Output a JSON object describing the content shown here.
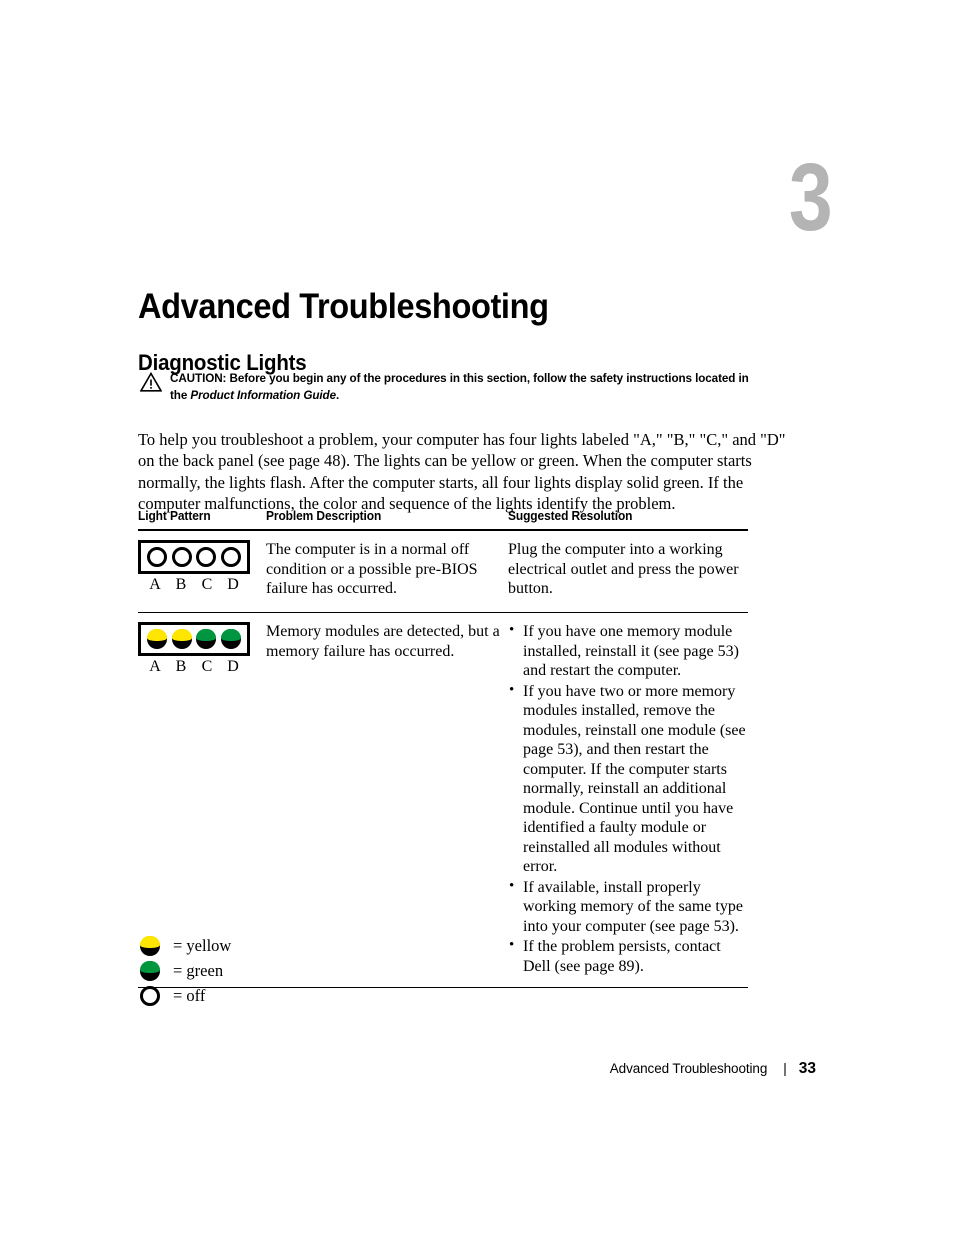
{
  "chapter": {
    "number": "3",
    "title": "Advanced Troubleshooting"
  },
  "section": {
    "title": "Diagnostic Lights"
  },
  "caution": {
    "icon": "warning-triangle-icon",
    "label": "CAUTION:",
    "text_before": " Before you begin any of the procedures in this section, follow the safety instructions located in the ",
    "italic_ref": "Product Information Guide",
    "text_after": "."
  },
  "intro": {
    "paragraph": "To help you troubleshoot a problem, your computer has four lights labeled \"A,\" \"B,\" \"C,\" and \"D\" on the back panel (see page 48). The lights can be yellow or green. When the computer starts normally, the lights flash. After the computer starts, all four lights display solid green. If the computer malfunctions, the color and sequence of the lights identify the problem."
  },
  "table": {
    "headers": {
      "light_pattern": "Light Pattern",
      "problem_description": "Problem Description",
      "suggested_resolution": "Suggested Resolution"
    },
    "rows": [
      {
        "lights": [
          "off",
          "off",
          "off",
          "off"
        ],
        "light_labels": [
          "A",
          "B",
          "C",
          "D"
        ],
        "problem": "The computer is in a normal off condition or a possible pre-BIOS failure has occurred.",
        "resolution_text": "Plug the computer into a working electrical outlet and press the power button.",
        "resolution_bullets": []
      },
      {
        "lights": [
          "yellow",
          "yellow",
          "green",
          "green"
        ],
        "light_labels": [
          "A",
          "B",
          "C",
          "D"
        ],
        "problem": "Memory modules are detected, but a memory failure has occurred.",
        "resolution_text": "",
        "resolution_bullets": [
          "If you have one memory module installed, reinstall it (see page 53) and restart the computer.",
          "If you have two or more memory modules installed, remove the modules, reinstall one module (see page 53), and then restart the computer. If the computer starts normally, reinstall an additional module. Continue until you have identified a faulty module or reinstalled all modules without error.",
          "If available, install properly working memory of the same type into your computer (see page 53).",
          "If the problem persists, contact Dell (see page 89)."
        ]
      }
    ]
  },
  "legend": [
    {
      "state": "yellow",
      "label": "= yellow"
    },
    {
      "state": "green",
      "label": "= green"
    },
    {
      "state": "off",
      "label": "= off"
    }
  ],
  "footer": {
    "title": "Advanced Troubleshooting",
    "separator": "|",
    "page_number": "33"
  },
  "colors": {
    "yellow": "#ffe600",
    "green": "#009640",
    "off": "#ffffff",
    "lamp_body": "#000000",
    "chapter_number": "#b4b4b4"
  }
}
